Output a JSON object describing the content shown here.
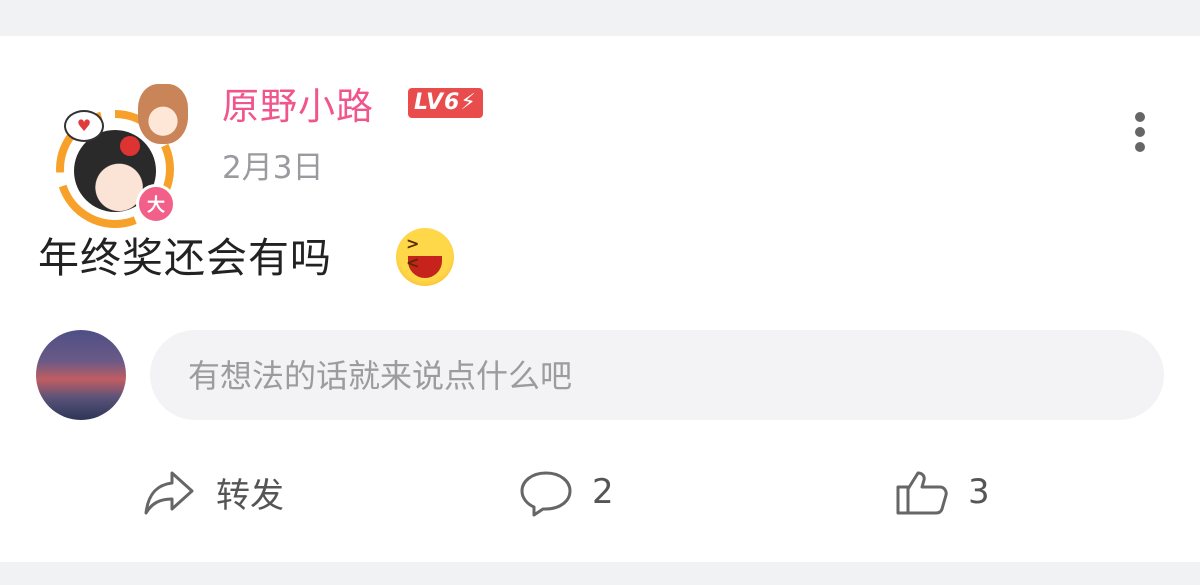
{
  "post": {
    "user_name": "原野小路",
    "level_badge": "LV6⚡",
    "avatar_badge": "大",
    "date": "2月3日",
    "content": "年终奖还会有吗",
    "emoji_icon": "laughing-face-icon"
  },
  "comment": {
    "placeholder": "有想法的话就来说点什么吧"
  },
  "actions": {
    "share_label": "转发",
    "comment_count": "2",
    "like_count": "3"
  },
  "colors": {
    "username": "#f0568b",
    "level_badge": "#e94c4c",
    "avatar_ring": "#f7a12a"
  }
}
